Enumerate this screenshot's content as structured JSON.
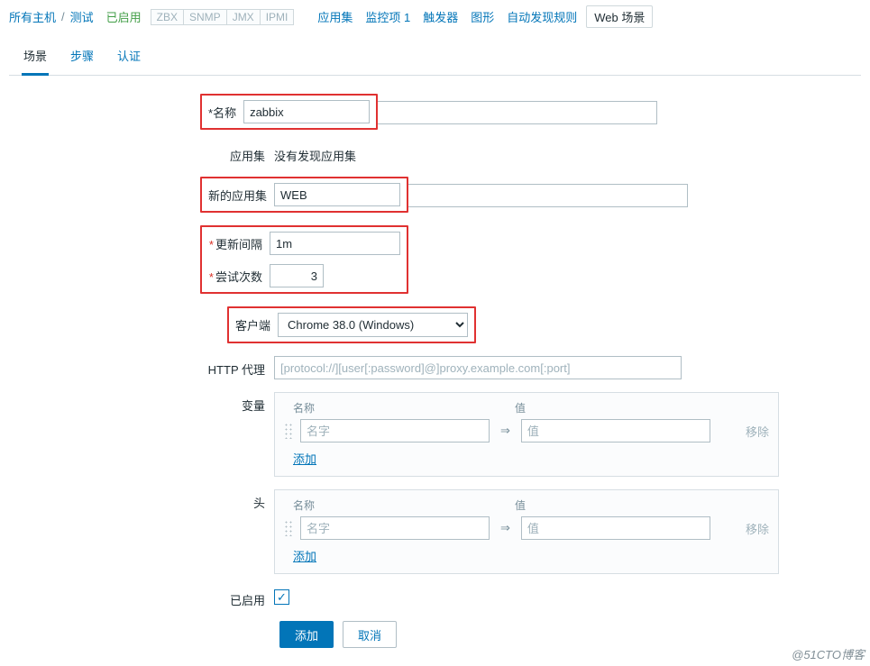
{
  "breadcrumb": {
    "all_hosts": "所有主机",
    "host": "测试",
    "status": "已启用"
  },
  "chips": [
    "ZBX",
    "SNMP",
    "JMX",
    "IPMI"
  ],
  "nav": {
    "apps": "应用集",
    "items": "监控项 1",
    "triggers": "触发器",
    "graphs": "图形",
    "discovery": "自动发现规则",
    "web": "Web 场景"
  },
  "tabs": {
    "scenario": "场景",
    "steps": "步骤",
    "auth": "认证"
  },
  "form": {
    "name_label": "名称",
    "name_value": "zabbix",
    "app_label": "应用集",
    "app_none": "没有发现应用集",
    "newapp_label": "新的应用集",
    "newapp_value": "WEB",
    "interval_label": "更新间隔",
    "interval_value": "1m",
    "retries_label": "尝试次数",
    "retries_value": "3",
    "agent_label": "客户端",
    "agent_value": "Chrome 38.0 (Windows)",
    "proxy_label": "HTTP 代理",
    "proxy_placeholder": "[protocol://][user[:password]@]proxy.example.com[:port]",
    "vars_label": "变量",
    "headers_label": "头",
    "col_name": "名称",
    "col_value": "值",
    "placeholder_name": "名字",
    "placeholder_value": "值",
    "arrow": "⇒",
    "remove": "移除",
    "add_link": "添加",
    "enabled_label": "已启用"
  },
  "actions": {
    "add": "添加",
    "cancel": "取消"
  },
  "watermark": "@51CTO博客"
}
